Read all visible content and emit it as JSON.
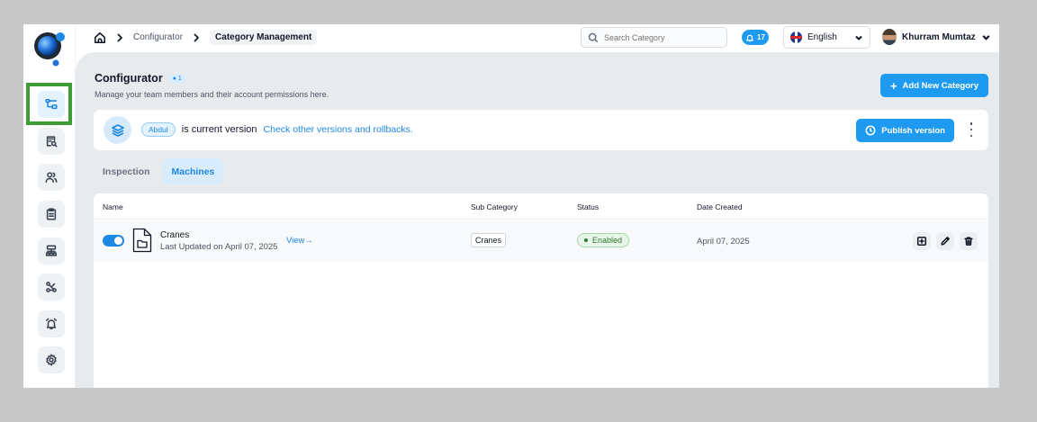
{
  "breadcrumb": {
    "items": [
      "Configurator"
    ],
    "current": "Category Management"
  },
  "search": {
    "placeholder": "Search Category"
  },
  "notifications": {
    "count": "17"
  },
  "language": {
    "selected": "English"
  },
  "user": {
    "name": "Khurram Mumtaz"
  },
  "sidebar": {
    "items": [
      {
        "icon": "category-management-icon",
        "active": true
      },
      {
        "icon": "document-search-icon",
        "active": false
      },
      {
        "icon": "users-icon",
        "active": false
      },
      {
        "icon": "clipboard-icon",
        "active": false
      },
      {
        "icon": "hierarchy-icon",
        "active": false
      },
      {
        "icon": "workflow-icon",
        "active": false
      },
      {
        "icon": "alarm-icon",
        "active": false
      },
      {
        "icon": "settings-icon",
        "active": false
      }
    ]
  },
  "page": {
    "title": "Configurator",
    "title_badge": "1",
    "subtitle": "Manage your team members and their account permissions here.",
    "add_button": "Add New Category"
  },
  "version": {
    "name": "Abdul",
    "text": "is current version",
    "link": "Check other versions and rollbacks.",
    "publish_button": "Publish version"
  },
  "tabs": [
    {
      "label": "Inspection",
      "active": false
    },
    {
      "label": "Machines",
      "active": true
    }
  ],
  "table": {
    "columns": [
      "Name",
      "Sub Category",
      "Status",
      "Date Created"
    ],
    "rows": [
      {
        "enabled": true,
        "name": "Cranes",
        "updated": "Last Updated on April 07, 2025",
        "view": "View",
        "sub_category": "Cranes",
        "status": "Enabled",
        "date_created": "April 07, 2025"
      }
    ]
  },
  "colors": {
    "accent": "#1e9bf0",
    "success": "#2e7d32",
    "highlight": "#3e9c35"
  }
}
